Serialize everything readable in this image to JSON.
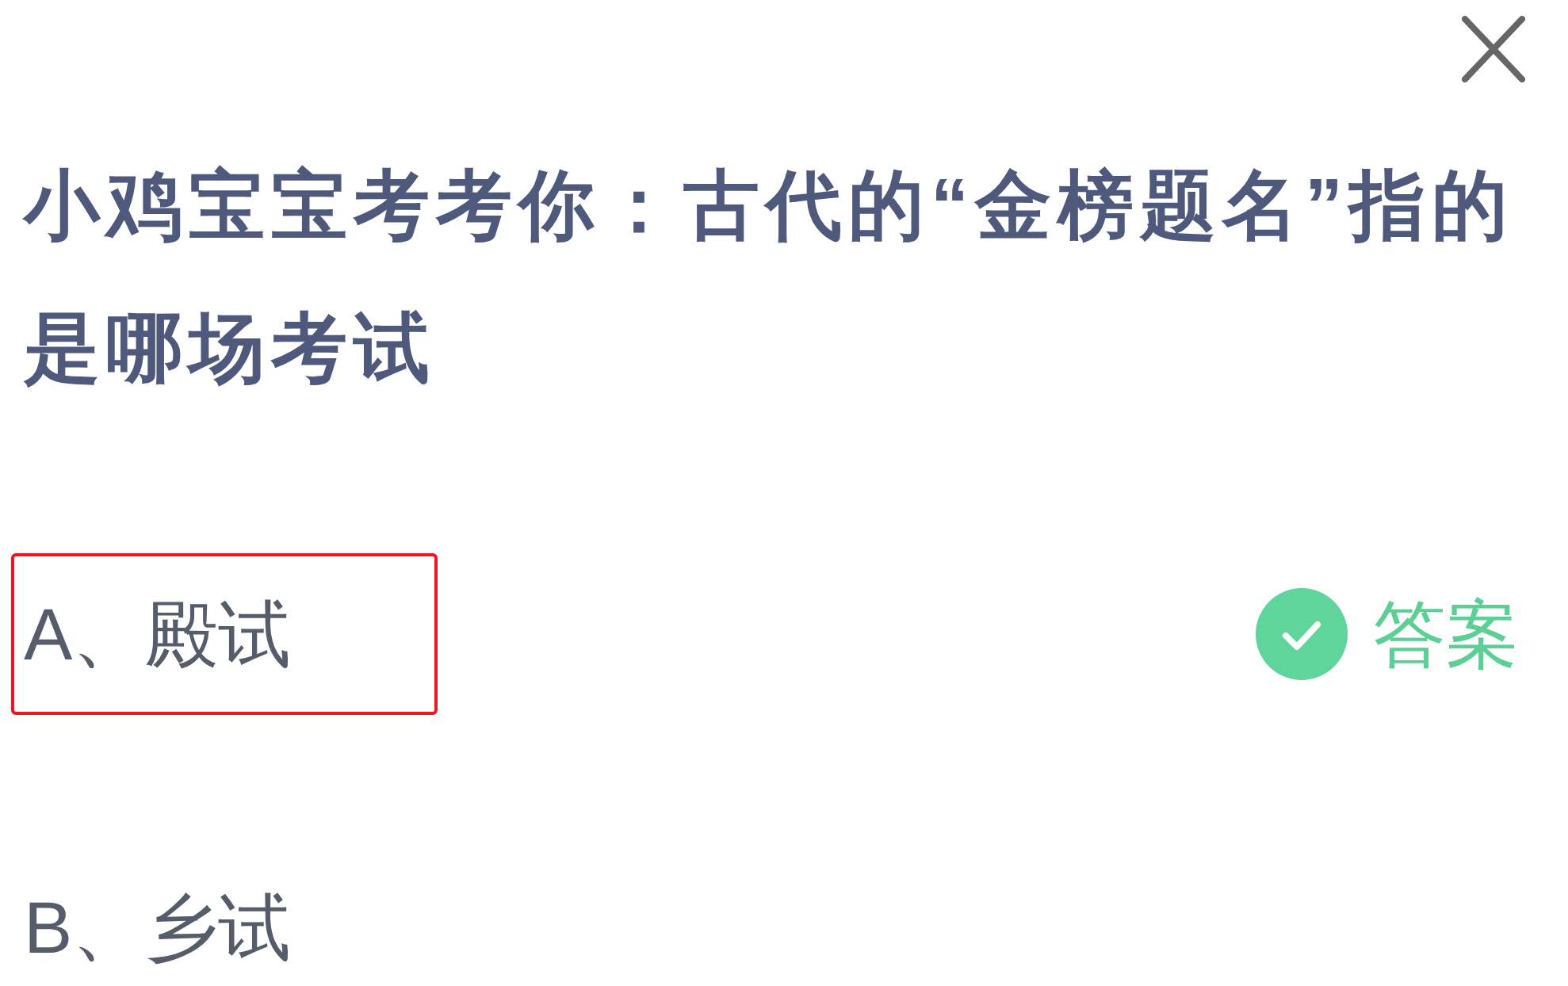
{
  "question": "小鸡宝宝考考你：古代的“金榜题名”指的是哪场考试",
  "options": [
    {
      "label": "A、殿试",
      "highlighted": true,
      "answer_badge": "答案"
    },
    {
      "label": "B、乡试",
      "highlighted": false
    }
  ]
}
